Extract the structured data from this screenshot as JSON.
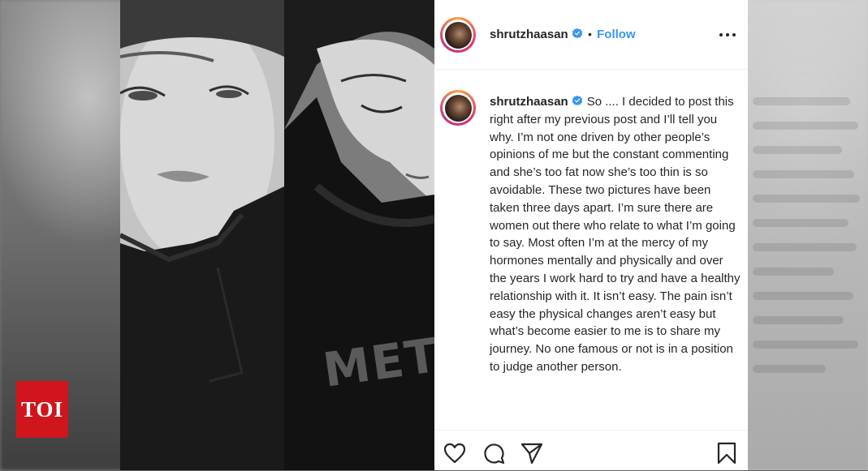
{
  "badge": {
    "text": "TOI",
    "color": "#d0161c"
  },
  "post": {
    "username": "shrutzhaasan",
    "verified": true,
    "follow_label": "Follow",
    "separator": "•",
    "caption": "So .... I decided to post this right after my previous post and I’ll tell you why. I’m not one driven by other people’s opinions of me but the constant commenting and she’s too fat now she’s too thin is so avoidable. These two pictures have been taken three days apart. I’m sure there are women out there who relate to what I’m going to say. Most often I’m at the mercy of my hormones mentally and physically and over the years I work hard to try and have a healthy relationship with it. It isn’t easy. The pain isn’t easy the physical changes aren’t easy but what’s become easier to me is to share my journey. No one famous or not is in a position to judge another person."
  },
  "photo": {
    "shirt_text": "META"
  },
  "icons": [
    "more-options-icon",
    "heart-icon",
    "comment-icon",
    "share-icon",
    "bookmark-icon",
    "verified-icon"
  ],
  "colors": {
    "follow": "#3897f0",
    "verified": "#3897f0",
    "text": "#262626"
  }
}
